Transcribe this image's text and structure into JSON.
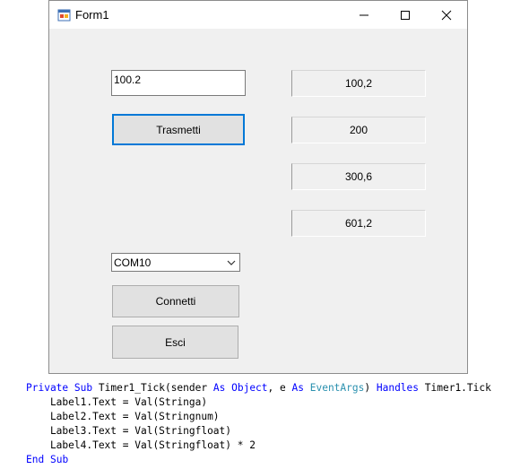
{
  "window": {
    "title": "Form1"
  },
  "form": {
    "input_value": "100.2",
    "transmit_button": "Trasmetti",
    "labels": [
      "100,2",
      "200",
      "300,6",
      "601,2"
    ],
    "port_select": "COM10",
    "connect_button": "Connetti",
    "exit_button": "Esci"
  },
  "code": {
    "line1": {
      "kw_private": "Private",
      "kw_sub": "Sub",
      "name": "Timer1_Tick(sender",
      "kw_as1": "As",
      "kw_object": "Object",
      "mid": ", e",
      "kw_as2": "As",
      "type_eventargs": "EventArgs",
      "close": ")",
      "kw_handles": "Handles",
      "handler": "Timer1.Tick"
    },
    "line2": "    Label1.Text = Val(Stringa)",
    "line3": "    Label2.Text = Val(Stringnum)",
    "line4": "    Label3.Text = Val(Stringfloat)",
    "line5": "    Label4.Text = Val(Stringfloat) * 2",
    "line6": {
      "kw_end": "End",
      "kw_sub": "Sub"
    }
  }
}
